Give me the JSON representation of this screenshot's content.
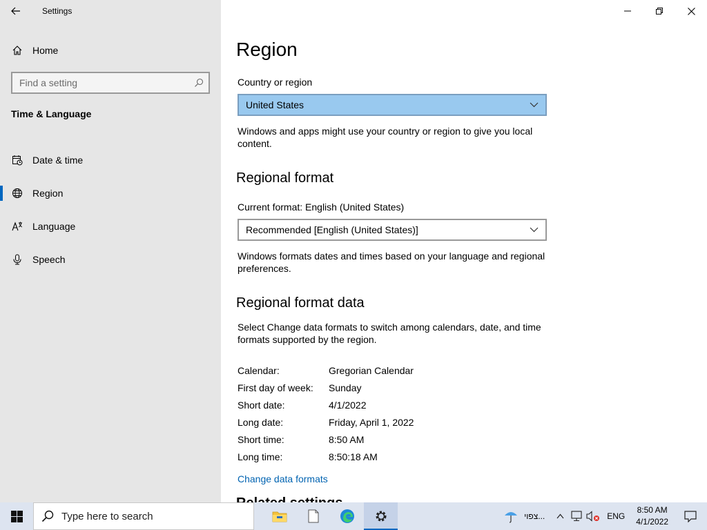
{
  "window": {
    "app_title": "Settings"
  },
  "sidebar": {
    "home_label": "Home",
    "search_placeholder": "Find a setting",
    "section_title": "Time & Language",
    "items": [
      {
        "label": "Date & time",
        "icon": "calendar-clock-icon"
      },
      {
        "label": "Region",
        "icon": "globe-icon",
        "active": true
      },
      {
        "label": "Language",
        "icon": "language-icon"
      },
      {
        "label": "Speech",
        "icon": "microphone-icon"
      }
    ]
  },
  "main": {
    "title": "Region",
    "country_label": "Country or region",
    "country_value": "United States",
    "country_desc": "Windows and apps might use your country or region to give you local content.",
    "regional_format_heading": "Regional format",
    "current_format_label": "Current format: English (United States)",
    "format_value": "Recommended [English (United States)]",
    "format_desc": "Windows formats dates and times based on your language and regional preferences.",
    "format_data_heading": "Regional format data",
    "format_data_desc": "Select Change data formats to switch among calendars, date, and time formats supported by the region.",
    "format_data": [
      {
        "key": "Calendar:",
        "value": "Gregorian Calendar"
      },
      {
        "key": "First day of week:",
        "value": "Sunday"
      },
      {
        "key": "Short date:",
        "value": "4/1/2022"
      },
      {
        "key": "Long date:",
        "value": "Friday, April 1, 2022"
      },
      {
        "key": "Short time:",
        "value": "8:50 AM"
      },
      {
        "key": "Long time:",
        "value": "8:50:18 AM"
      }
    ],
    "change_link": "Change data formats",
    "related_heading": "Related settings"
  },
  "taskbar": {
    "search_placeholder": "Type here to search",
    "weather_text": "צפוי...",
    "lang": "ENG",
    "time": "8:50 AM",
    "date": "4/1/2022"
  },
  "colors": {
    "accent": "#0067c0",
    "selected_dropdown": "#99c9ef",
    "link": "#0063b1"
  }
}
